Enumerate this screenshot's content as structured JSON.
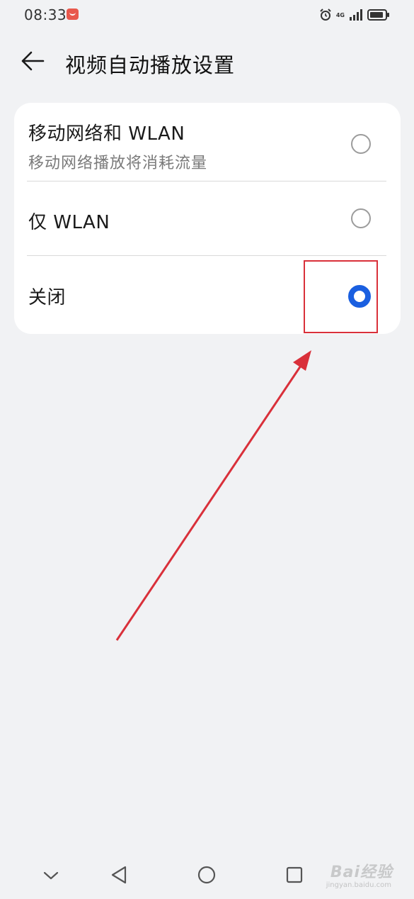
{
  "status_bar": {
    "time": "08:33",
    "network": "4G",
    "icons": [
      "alarm-icon",
      "signal-icon",
      "battery-icon"
    ]
  },
  "header": {
    "back_icon": "arrow-left-icon",
    "title": "视频自动播放设置"
  },
  "options": [
    {
      "title": "移动网络和 WLAN",
      "subtitle": "移动网络播放将消耗流量",
      "selected": false
    },
    {
      "title": "仅 WLAN",
      "selected": false
    },
    {
      "title": "关闭",
      "selected": true
    }
  ],
  "nav_bar": {
    "icons": [
      "chevron-down-icon",
      "triangle-back-icon",
      "circle-home-icon",
      "square-recent-icon"
    ]
  },
  "watermark": {
    "text": "Bai经验",
    "sub": "jingyan.baidu.com"
  },
  "colors": {
    "accent": "#1a5fe0",
    "annotation": "#d9303a",
    "background": "#f1f2f4"
  }
}
